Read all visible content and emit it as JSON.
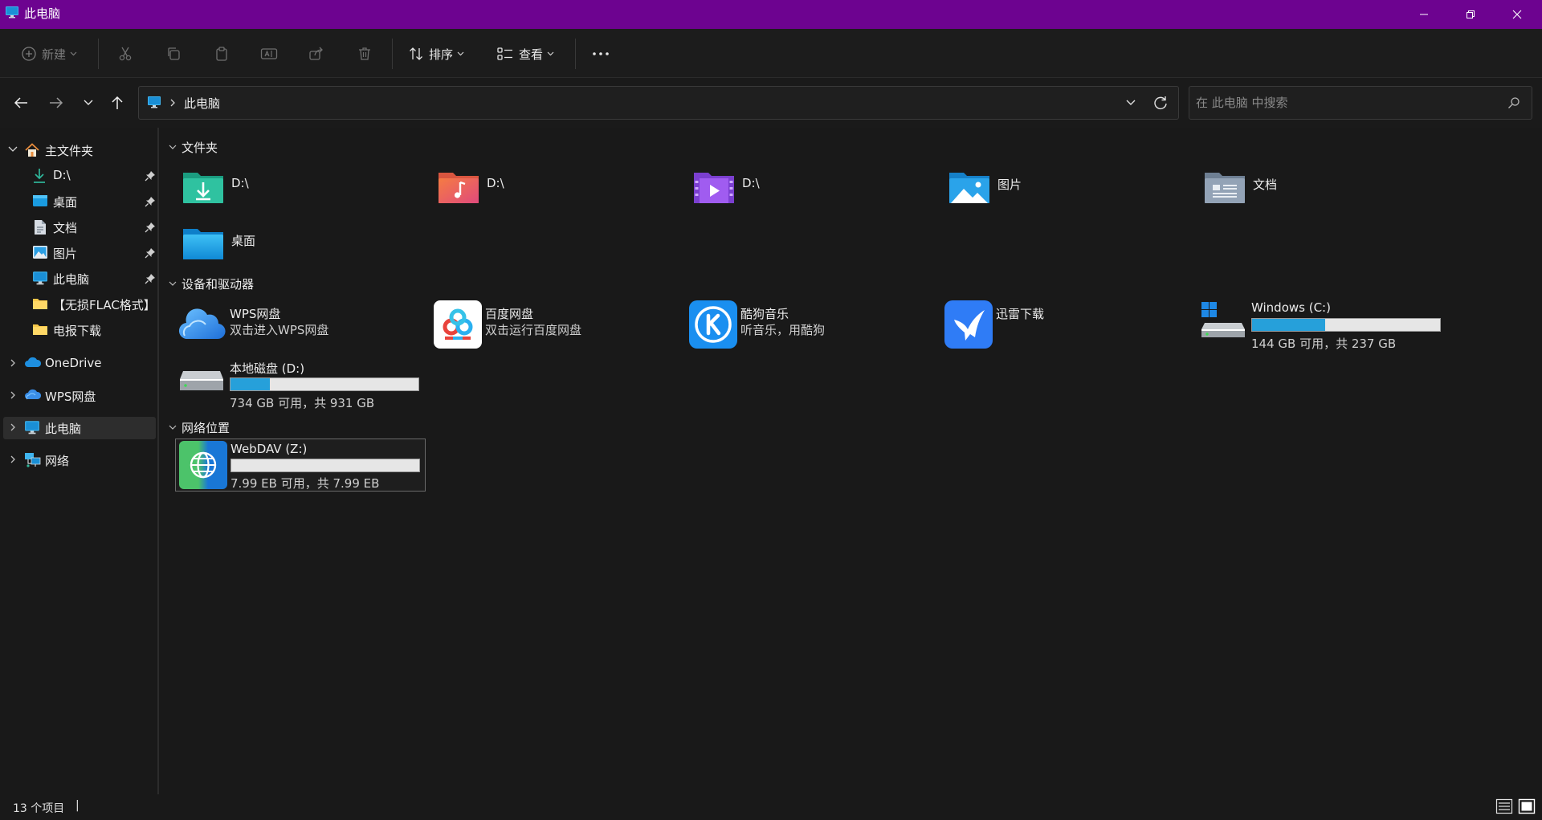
{
  "window": {
    "title": "此电脑",
    "accent": "#6d0390"
  },
  "toolbar": {
    "new_label": "新建",
    "sort_label": "排序",
    "view_label": "查看",
    "more_label": "•••"
  },
  "address": {
    "crumb": "此电脑"
  },
  "search": {
    "placeholder": "在 此电脑 中搜索"
  },
  "sidebar": {
    "home": {
      "label": "主文件夹"
    },
    "pinned": [
      {
        "label": "D:\\",
        "icon": "download-icon"
      },
      {
        "label": "桌面",
        "icon": "desktop-icon"
      },
      {
        "label": "文档",
        "icon": "document-icon"
      },
      {
        "label": "图片",
        "icon": "picture-icon"
      },
      {
        "label": "此电脑",
        "icon": "computer-icon"
      },
      {
        "label": "【无损FLAC格式】",
        "icon": "folder-icon"
      },
      {
        "label": "电报下载",
        "icon": "folder-icon"
      }
    ],
    "groups": [
      {
        "label": "OneDrive",
        "icon": "onedrive-icon"
      },
      {
        "label": "WPS网盘",
        "icon": "wps-cloud-icon"
      },
      {
        "label": "此电脑",
        "icon": "computer-icon"
      },
      {
        "label": "网络",
        "icon": "network-icon"
      }
    ]
  },
  "main": {
    "sections": {
      "folders": "文件夹",
      "devices": "设备和驱动器",
      "network": "网络位置"
    },
    "folders": [
      {
        "label": "D:\\",
        "icon": "downloads-folder-icon"
      },
      {
        "label": "D:\\",
        "icon": "music-folder-icon"
      },
      {
        "label": "D:\\",
        "icon": "videos-folder-icon"
      },
      {
        "label": "图片",
        "icon": "pictures-folder-icon"
      },
      {
        "label": "文档",
        "icon": "documents-folder-icon"
      },
      {
        "label": "桌面",
        "icon": "desktop-folder-icon"
      }
    ],
    "devices": [
      {
        "name": "WPS网盘",
        "sub": "双击进入WPS网盘",
        "icon": "wps-cloud-icon"
      },
      {
        "name": "百度网盘",
        "sub": "双击运行百度网盘",
        "icon": "baidu-netdisk-icon"
      },
      {
        "name": "酷狗音乐",
        "sub": "听音乐，用酷狗",
        "icon": "kugou-icon"
      },
      {
        "name": "迅雷下载",
        "sub": "",
        "icon": "xunlei-icon"
      }
    ],
    "drives": [
      {
        "name": "Windows (C:)",
        "sub": "144 GB 可用，共 237 GB",
        "used_fraction": 0.39
      },
      {
        "name": "本地磁盘 (D:)",
        "sub": "734 GB 可用，共 931 GB",
        "used_fraction": 0.21
      }
    ],
    "network_locations": [
      {
        "name": "WebDAV (Z:)",
        "sub": "7.99 EB 可用，共 7.99 EB",
        "used_fraction": 0.0
      }
    ]
  },
  "status": {
    "count": "13 个项目",
    "cursor": "|"
  }
}
